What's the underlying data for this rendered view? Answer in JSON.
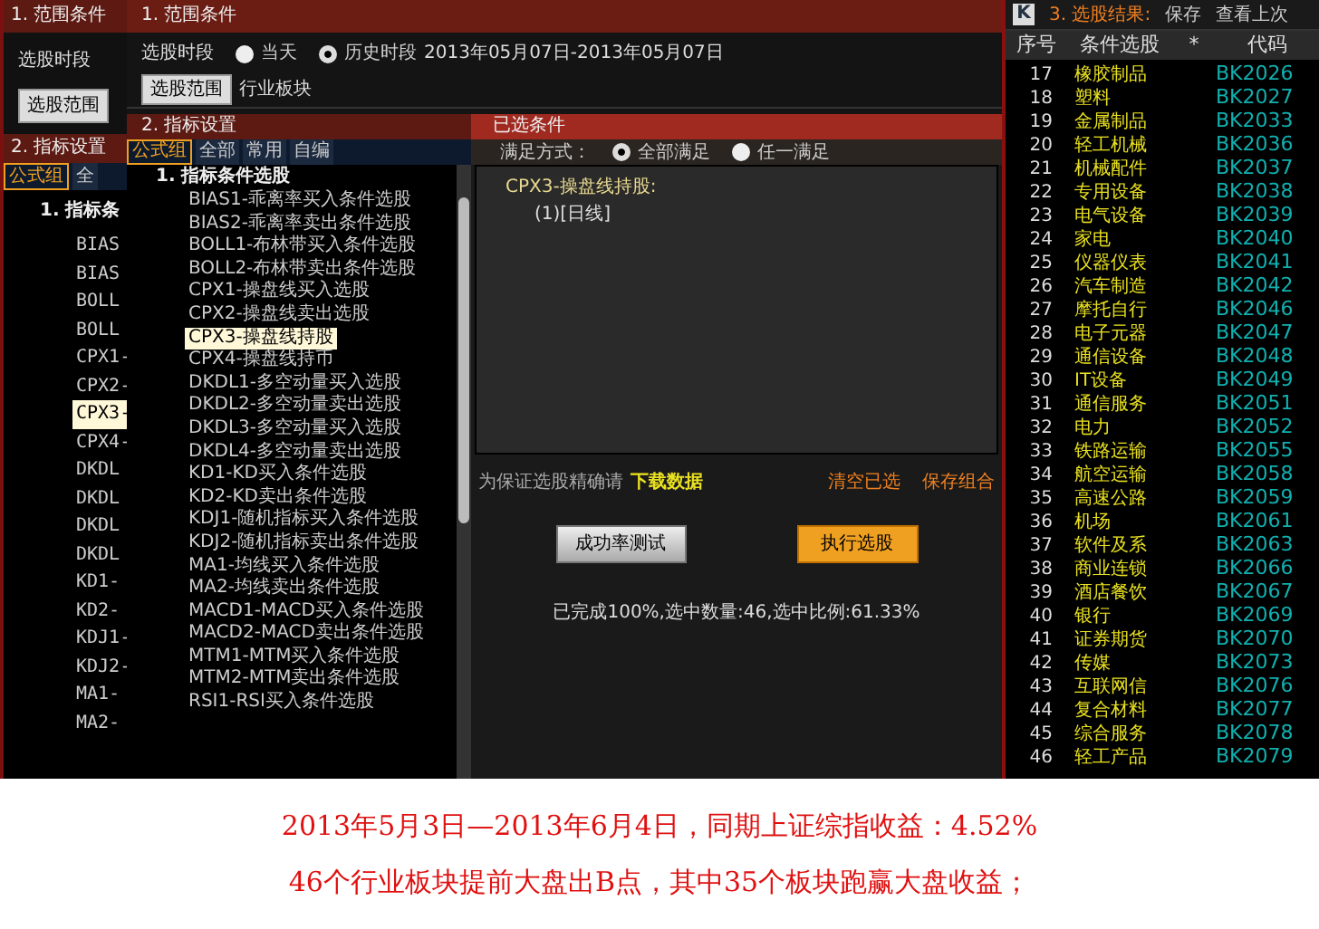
{
  "back_window": {
    "range_header": "1. 范围条件",
    "period_label": "选股时段",
    "range_button": "选股范围",
    "indicator_header": "2. 指标设置",
    "tabs": [
      {
        "label": "公式组",
        "selected": true
      },
      {
        "label": "全",
        "selected": false
      }
    ],
    "group_title": "1. 指标条",
    "items": [
      {
        "label": "BIAS",
        "selected": false
      },
      {
        "label": "BIAS",
        "selected": false
      },
      {
        "label": "BOLL",
        "selected": false
      },
      {
        "label": "BOLL",
        "selected": false
      },
      {
        "label": "CPX1-",
        "selected": false
      },
      {
        "label": "CPX2-",
        "selected": false
      },
      {
        "label": "CPX3-",
        "selected": true
      },
      {
        "label": "CPX4-",
        "selected": false
      },
      {
        "label": "DKDL",
        "selected": false
      },
      {
        "label": "DKDL",
        "selected": false
      },
      {
        "label": "DKDL",
        "selected": false
      },
      {
        "label": "DKDL",
        "selected": false
      },
      {
        "label": "KD1-",
        "selected": false
      },
      {
        "label": "KD2-",
        "selected": false
      },
      {
        "label": "KDJ1-",
        "selected": false
      },
      {
        "label": "KDJ2-",
        "selected": false
      },
      {
        "label": "MA1-",
        "selected": false
      },
      {
        "label": "MA2-",
        "selected": false
      }
    ]
  },
  "dialog": {
    "range_header": "1. 范围条件",
    "period_label": "选股时段",
    "period_options": [
      {
        "label": "当天",
        "selected": false
      },
      {
        "label": "历史时段",
        "selected": true
      }
    ],
    "date_range": "2013年05月07日-2013年05月07日",
    "range_button": "选股范围",
    "range_value": "行业板块",
    "indicator_header": "2. 指标设置",
    "tabs": [
      {
        "label": "公式组",
        "selected": true
      },
      {
        "label": "全部",
        "selected": false
      },
      {
        "label": "常用",
        "selected": false
      },
      {
        "label": "自编",
        "selected": false
      }
    ],
    "group_title": "1. 指标条件选股",
    "items": [
      {
        "label": "BIAS1-乖离率买入条件选股",
        "selected": false
      },
      {
        "label": "BIAS2-乖离率卖出条件选股",
        "selected": false
      },
      {
        "label": "BOLL1-布林带买入条件选股",
        "selected": false
      },
      {
        "label": "BOLL2-布林带卖出条件选股",
        "selected": false
      },
      {
        "label": "CPX1-操盘线买入选股",
        "selected": false
      },
      {
        "label": "CPX2-操盘线卖出选股",
        "selected": false
      },
      {
        "label": "CPX3-操盘线持股",
        "selected": true
      },
      {
        "label": "CPX4-操盘线持币",
        "selected": false
      },
      {
        "label": "DKDL1-多空动量买入选股",
        "selected": false
      },
      {
        "label": "DKDL2-多空动量卖出选股",
        "selected": false
      },
      {
        "label": "DKDL3-多空动量买入选股",
        "selected": false
      },
      {
        "label": "DKDL4-多空动量卖出选股",
        "selected": false
      },
      {
        "label": "KD1-KD买入条件选股",
        "selected": false
      },
      {
        "label": "KD2-KD卖出条件选股",
        "selected": false
      },
      {
        "label": "KDJ1-随机指标买入条件选股",
        "selected": false
      },
      {
        "label": "KDJ2-随机指标卖出条件选股",
        "selected": false
      },
      {
        "label": "MA1-均线买入条件选股",
        "selected": false
      },
      {
        "label": "MA2-均线卖出条件选股",
        "selected": false
      },
      {
        "label": "MACD1-MACD买入条件选股",
        "selected": false
      },
      {
        "label": "MACD2-MACD卖出条件选股",
        "selected": false
      },
      {
        "label": "MTM1-MTM买入条件选股",
        "selected": false
      },
      {
        "label": "MTM2-MTM卖出条件选股",
        "selected": false
      },
      {
        "label": "RSI1-RSI买入条件选股",
        "selected": false
      }
    ],
    "selected_header": "已选条件",
    "match_label": "满足方式：",
    "match_options": [
      {
        "label": "全部满足",
        "selected": true
      },
      {
        "label": "任一满足",
        "selected": false
      }
    ],
    "condition_title": "CPX3-操盘线持股:",
    "condition_detail": "(1)[日线]",
    "notice": "为保证选股精确请",
    "download_link": "下载数据",
    "clear_link": "清空已选",
    "save_link": "保存组合",
    "test_button": "成功率测试",
    "run_button": "执行选股",
    "progress_text": "已完成100%,选中数量:46,选中比例:61.33%"
  },
  "results": {
    "logo": "K",
    "title": "3. 选股结果:",
    "save": "保存",
    "view_last": "查看上次",
    "columns": [
      "序号",
      "条件选股",
      "*",
      "代码"
    ],
    "rows": [
      [
        "17",
        "橡胶制品",
        "BK2026"
      ],
      [
        "18",
        "塑料",
        "BK2027"
      ],
      [
        "19",
        "金属制品",
        "BK2033"
      ],
      [
        "20",
        "轻工机械",
        "BK2036"
      ],
      [
        "21",
        "机械配件",
        "BK2037"
      ],
      [
        "22",
        "专用设备",
        "BK2038"
      ],
      [
        "23",
        "电气设备",
        "BK2039"
      ],
      [
        "24",
        "家电",
        "BK2040"
      ],
      [
        "25",
        "仪器仪表",
        "BK2041"
      ],
      [
        "26",
        "汽车制造",
        "BK2042"
      ],
      [
        "27",
        "摩托自行",
        "BK2046"
      ],
      [
        "28",
        "电子元器",
        "BK2047"
      ],
      [
        "29",
        "通信设备",
        "BK2048"
      ],
      [
        "30",
        "IT设备",
        "BK2049"
      ],
      [
        "31",
        "通信服务",
        "BK2051"
      ],
      [
        "32",
        "电力",
        "BK2052"
      ],
      [
        "33",
        "铁路运输",
        "BK2055"
      ],
      [
        "34",
        "航空运输",
        "BK2058"
      ],
      [
        "35",
        "高速公路",
        "BK2059"
      ],
      [
        "36",
        "机场",
        "BK2061"
      ],
      [
        "37",
        "软件及系",
        "BK2063"
      ],
      [
        "38",
        "商业连锁",
        "BK2066"
      ],
      [
        "39",
        "酒店餐饮",
        "BK2067"
      ],
      [
        "40",
        "银行",
        "BK2069"
      ],
      [
        "41",
        "证券期货",
        "BK2070"
      ],
      [
        "42",
        "传媒",
        "BK2073"
      ],
      [
        "43",
        "互联网信",
        "BK2076"
      ],
      [
        "44",
        "复合材料",
        "BK2077"
      ],
      [
        "45",
        "综合服务",
        "BK2078"
      ],
      [
        "46",
        "轻工产品",
        "BK2079"
      ]
    ]
  },
  "caption": [
    "2013年5月3日—2013年6月4日，同期上证综指收益：4.52%",
    "46个行业板块提前大盘出B点，其中35个板块跑赢大盘收益；"
  ]
}
